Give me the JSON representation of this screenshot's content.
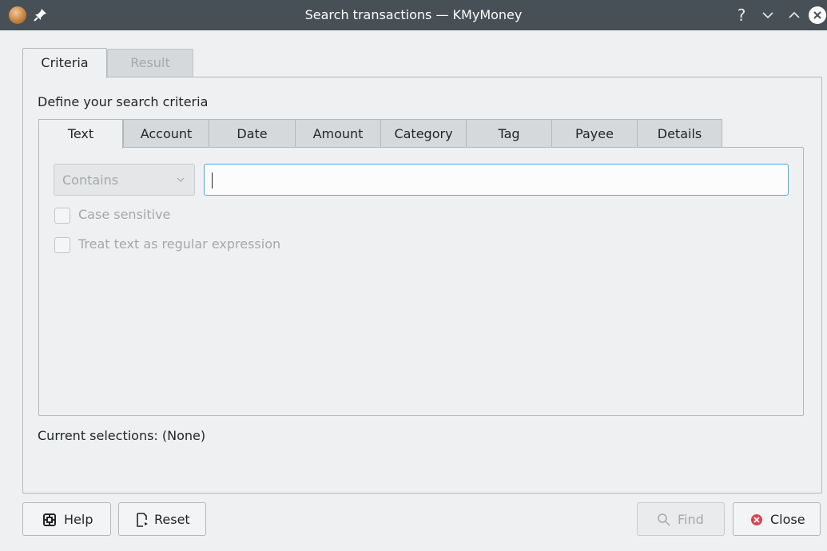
{
  "window": {
    "title": "Search transactions — KMyMoney",
    "help_glyph": "?"
  },
  "outer_tabs": [
    {
      "label": "Criteria",
      "active": true
    },
    {
      "label": "Result",
      "active": false,
      "disabled": true
    }
  ],
  "criteria": {
    "heading": "Define your search criteria",
    "inner_tabs": [
      {
        "label": "Text",
        "active": true
      },
      {
        "label": "Account"
      },
      {
        "label": "Date"
      },
      {
        "label": "Amount"
      },
      {
        "label": "Category"
      },
      {
        "label": "Tag"
      },
      {
        "label": "Payee"
      },
      {
        "label": "Details"
      }
    ],
    "text_tab": {
      "match_mode": "Contains",
      "search_text": "",
      "case_sensitive": {
        "label": "Case sensitive",
        "checked": false
      },
      "regex": {
        "label": "Treat text as regular expression",
        "checked": false
      }
    },
    "current_selections": "Current selections: (None)"
  },
  "buttons": {
    "help": "Help",
    "reset": "Reset",
    "find": "Find",
    "close": "Close"
  },
  "colors": {
    "titlebar": "#475057",
    "accent": "#3daee9",
    "close_red": "#da4453"
  }
}
